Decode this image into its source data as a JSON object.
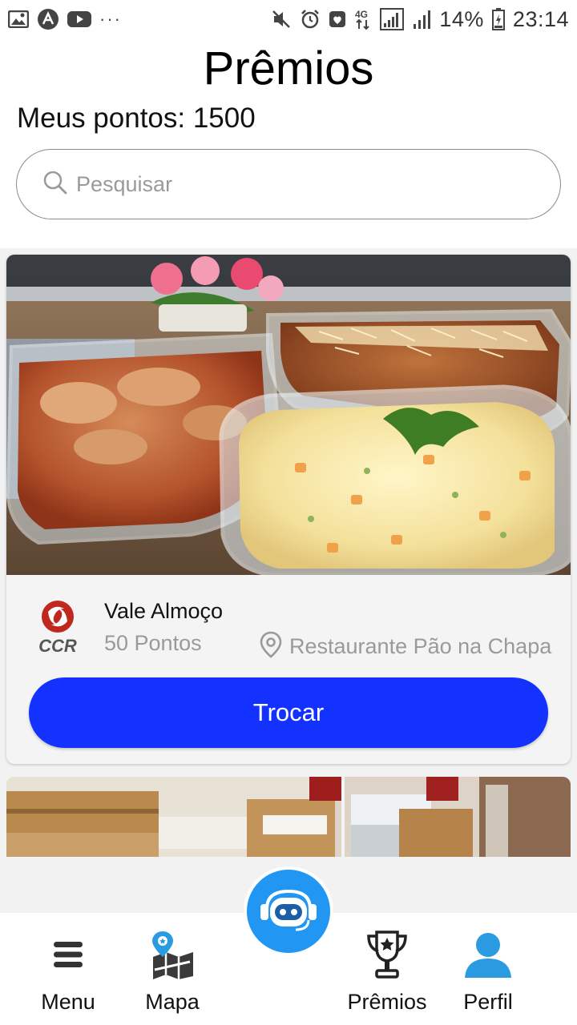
{
  "status_bar": {
    "battery": "14%",
    "time": "23:14",
    "network": "4G",
    "more": "···",
    "icons_left": [
      "gallery-icon",
      "app-icon",
      "youtube-icon",
      "more-icon"
    ],
    "icons_right": [
      "mute-icon",
      "alarm-icon",
      "shield-icon",
      "network-4g-icon",
      "signal-icon",
      "signal-icon-2",
      "battery-icon"
    ]
  },
  "header": {
    "title": "Prêmios",
    "points": "Meus pontos: 1500"
  },
  "search": {
    "placeholder": "Pesquisar",
    "value": ""
  },
  "reward_card": {
    "title": "Vale Almoço",
    "points": "50 Pontos",
    "location": "Restaurante Pão na Chapa",
    "button_label": "Trocar",
    "logo_text": "CCR",
    "image": "food-dishes-image"
  },
  "bottom_nav": {
    "items": [
      {
        "label": "Menu",
        "icon": "hamburger-icon"
      },
      {
        "label": "Mapa",
        "icon": "map-icon"
      },
      {
        "label": "Prêmios",
        "icon": "trophy-icon"
      },
      {
        "label": "Perfil",
        "icon": "user-icon"
      }
    ],
    "fab_icon": "chatbot-icon"
  },
  "colors": {
    "accent": "#1432ff",
    "fab": "#2196f3",
    "profile_icon": "#2a9be0",
    "logo_red": "#c0281e"
  }
}
